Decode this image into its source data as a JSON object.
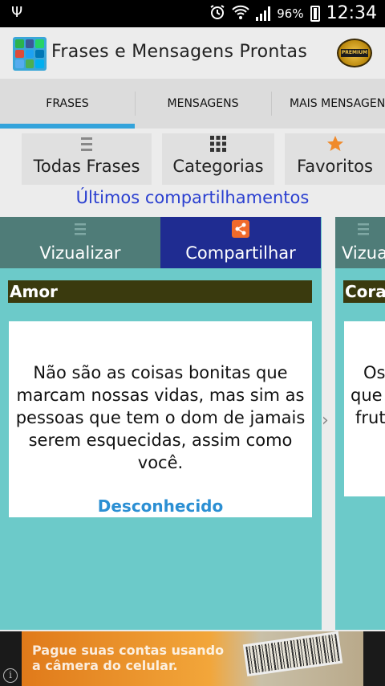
{
  "status_bar": {
    "usb_icon": "usb-icon",
    "battery_percent": "96%",
    "time": "12:34"
  },
  "action_bar": {
    "title": "Frases e Mensagens Prontas",
    "app_icon": "social-apps-icon",
    "premium_icon": "premium-badge-icon",
    "premium_text": "PREMIUM"
  },
  "tabs": [
    {
      "label": "FRASES",
      "selected": true
    },
    {
      "label": "MENSAGENS",
      "selected": false
    },
    {
      "label": "MAIS MENSAGENS",
      "selected": false
    }
  ],
  "shortcuts": [
    {
      "label": "Todas Frases",
      "icon": "list-icon"
    },
    {
      "label": "Categorias",
      "icon": "grid-icon"
    },
    {
      "label": "Favoritos",
      "icon": "star-icon"
    }
  ],
  "latest_shares_label": "Últimos compartilhamentos",
  "cards": [
    {
      "view_label": "Vizualizar",
      "share_label": "Compartilhar",
      "category": "Amor",
      "quote": "Não são as coisas bonitas que marcam nossas vidas, mas sim as pessoas que tem o dom de jamais serem esquecidas, assim como você.",
      "author": "Desconhecido"
    },
    {
      "view_label": "Vizua",
      "category": "Cora",
      "quote_lines": [
        "Os",
        "que",
        "frut"
      ]
    }
  ],
  "ad": {
    "text_line1": "Pague suas contas usando",
    "text_line2": "a câmera do celular.",
    "info_icon": "info-icon"
  },
  "colors": {
    "tab_indicator": "#33a3db",
    "card_background": "#6ccac9",
    "view_button": "#4f7c78",
    "share_button": "#1f2c91",
    "category_bar": "#3a3a0e",
    "author": "#2b8fd3",
    "latest_label": "#2a3fd0"
  }
}
